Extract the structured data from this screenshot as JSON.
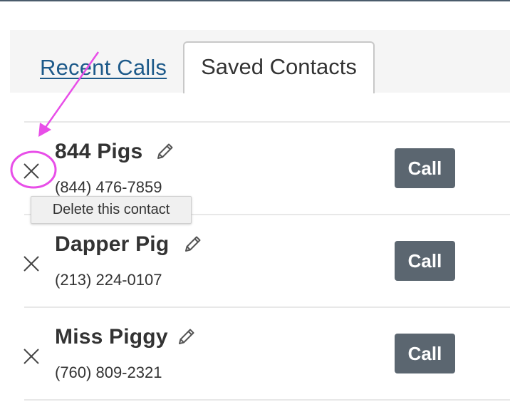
{
  "tabs": {
    "recent_calls": "Recent Calls",
    "saved_contacts": "Saved Contacts"
  },
  "contacts": [
    {
      "name": "844 Pigs",
      "phone": "(844) 476-7859",
      "call_label": "Call"
    },
    {
      "name": "Dapper Pig",
      "phone": "(213) 224-0107",
      "call_label": "Call"
    },
    {
      "name": "Miss Piggy",
      "phone": "(760) 809-2321",
      "call_label": "Call"
    }
  ],
  "tooltip": {
    "text": "Delete this contact"
  },
  "colors": {
    "link": "#1d5a8a",
    "call_button": "#5b6670",
    "annotation": "#e84ee8",
    "top_rule": "#4a5b6b"
  },
  "icons": {
    "delete": "close-icon",
    "edit": "pencil-icon"
  }
}
